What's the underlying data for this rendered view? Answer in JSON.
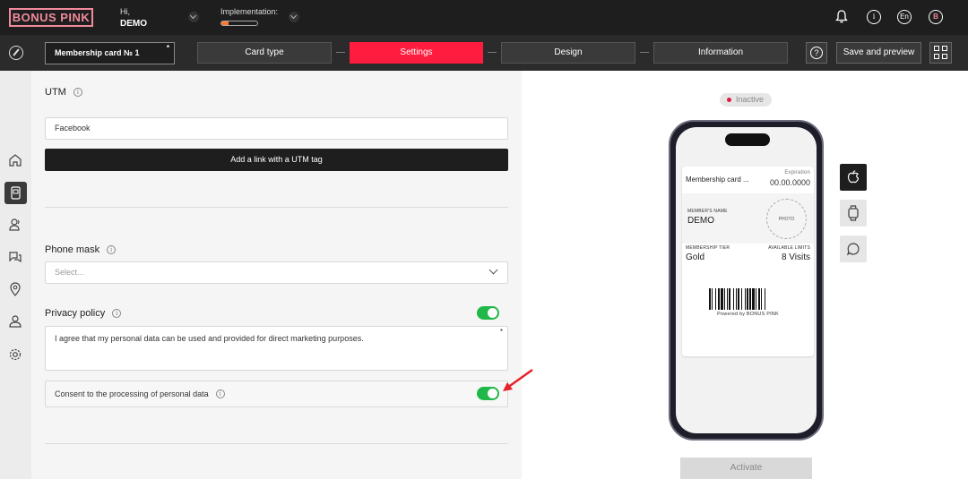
{
  "header": {
    "logo": "BONUS PINK",
    "greeting": "Hi,",
    "user_name": "DEMO",
    "implementation_label": "Implementation:",
    "implementation_progress": 0.2,
    "language": "En",
    "avatar_letter": "B"
  },
  "toolbar": {
    "card_name": "Membership card № 1",
    "card_name_required_mark": "*",
    "steps": [
      {
        "label": "Card type",
        "active": false
      },
      {
        "label": "Settings",
        "active": true
      },
      {
        "label": "Design",
        "active": false
      },
      {
        "label": "Information",
        "active": false
      }
    ],
    "help": "?",
    "save_label": "Save and preview"
  },
  "settings": {
    "utm": {
      "title": "UTM",
      "value": "Facebook",
      "add_button": "Add a link with a UTM tag"
    },
    "phone_mask": {
      "title": "Phone mask",
      "placeholder": "Select..."
    },
    "privacy_policy": {
      "title": "Privacy policy",
      "enabled": true,
      "text": "I agree that my personal data can be used and provided for direct marketing purposes.",
      "required_mark": "*"
    },
    "consent": {
      "label": "Consent to the processing of personal data",
      "enabled": true
    }
  },
  "preview": {
    "status": "Inactive",
    "card": {
      "title": "Membership card ...",
      "expiration_label": "Expiration",
      "expiration_value": "00.00.0000",
      "member_name_label": "MEMBER'S NAME",
      "member_name": "DEMO",
      "photo_label": "PHOTO",
      "tier_label": "MEMBERSHIP TIER",
      "tier_value": "Gold",
      "limits_label": "AVAILABLE LIMITS",
      "limits_value": "8 Visits",
      "powered_by": "Powered by BONUS PINK"
    },
    "platforms": [
      "apple-icon",
      "watch-icon",
      "chat-icon"
    ],
    "activate_label": "Activate"
  },
  "colors": {
    "accent": "#ff1c3e",
    "logo": "#f08a9c",
    "toggle_on": "#21b84a",
    "dark": "#1e1e1e"
  }
}
